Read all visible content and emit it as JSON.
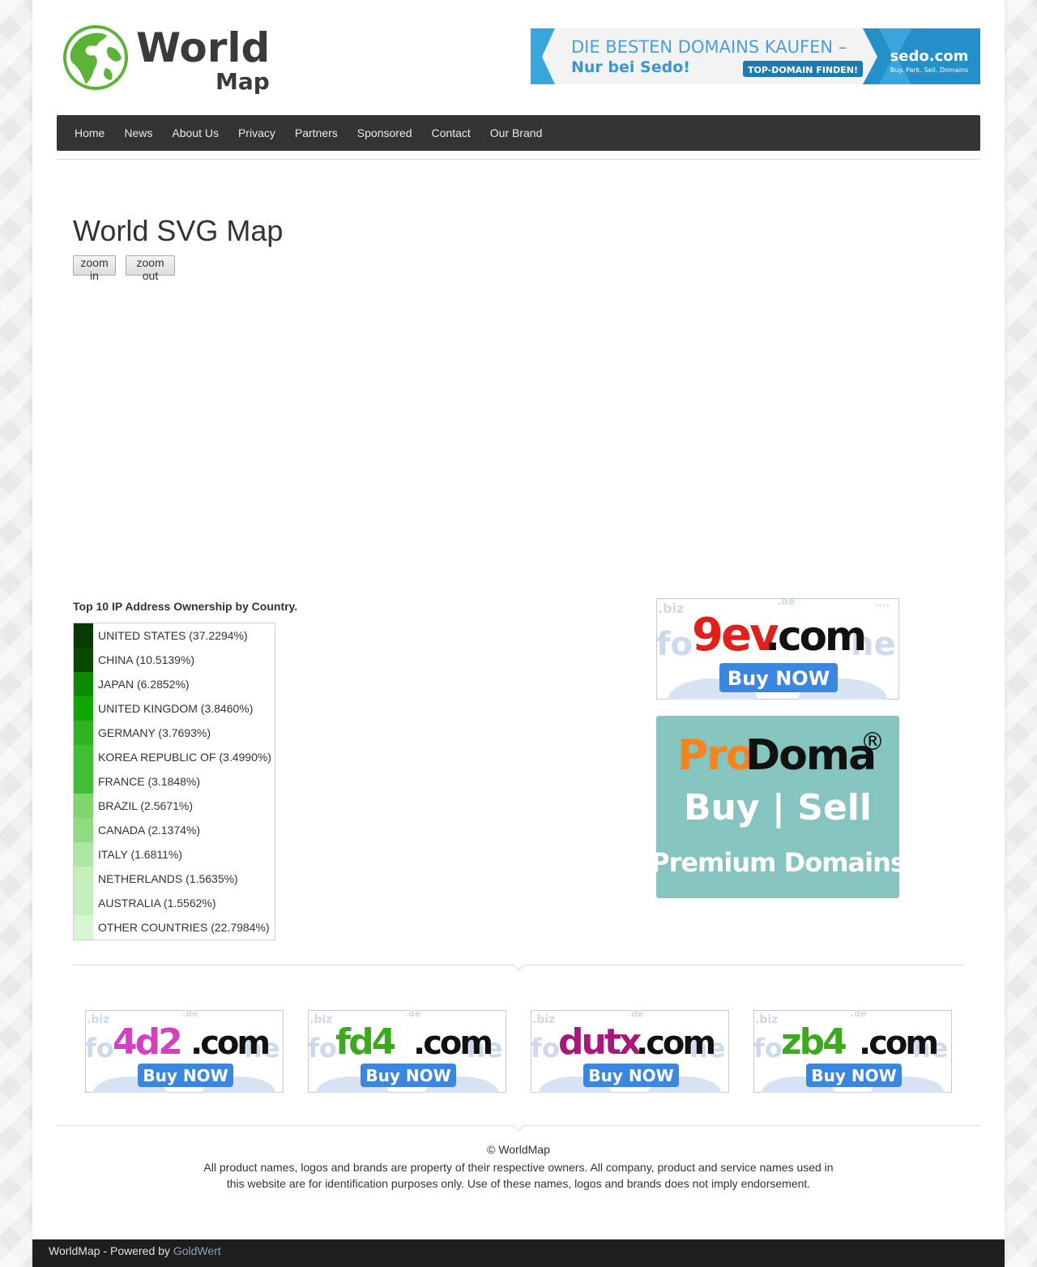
{
  "header": {
    "logo": {
      "word1": "World",
      "word2": "Map"
    },
    "banner": {
      "line1": "DIE BESTEN DOMAINS KAUFEN –",
      "line2": "Nur bei Sedo!",
      "cta": "TOP-DOMAIN FINDEN!",
      "brand": "sedo.com",
      "tagline": "Buy. Park. Sell. Domains"
    }
  },
  "nav": [
    "Home",
    "News",
    "About Us",
    "Privacy",
    "Partners",
    "Sponsored",
    "Contact",
    "Our Brand"
  ],
  "main": {
    "title": "World SVG Map",
    "zoom_in": "zoom in",
    "zoom_out": "zoom out",
    "legend_title": "Top 10 IP Address Ownership by Country.",
    "legend": [
      {
        "label": "UNITED STATES (37.2294%)",
        "color": "#073b00"
      },
      {
        "label": "CHINA (10.5139%)",
        "color": "#0a4a00"
      },
      {
        "label": "JAPAN (6.2852%)",
        "color": "#0c8a00"
      },
      {
        "label": "UNITED KINGDOM (3.8460%)",
        "color": "#11a500"
      },
      {
        "label": "GERMANY (3.7693%)",
        "color": "#2db41e"
      },
      {
        "label": "KOREA REPUBLIC OF (3.4990%)",
        "color": "#3fbf33"
      },
      {
        "label": "FRANCE (3.1848%)",
        "color": "#3fbf33"
      },
      {
        "label": "BRAZIL (2.5671%)",
        "color": "#7fd66f"
      },
      {
        "label": "CANADA (2.1374%)",
        "color": "#8fdc80"
      },
      {
        "label": "ITALY (1.6811%)",
        "color": "#aee6a3"
      },
      {
        "label": "NETHERLANDS (1.5635%)",
        "color": "#c5eebd"
      },
      {
        "label": "AUSTRALIA (1.5562%)",
        "color": "#c5eebd"
      },
      {
        "label": "OTHER COUNTRIES (22.7984%)",
        "color": "#d9f4d3"
      }
    ]
  },
  "ads": {
    "side": {
      "name": "9ev",
      "tld": ".com",
      "cta": "Buy NOW"
    },
    "prodoma": {
      "pro": "Pro",
      "doma": "Doma",
      "reg": "®",
      "line1": "Buy | Sell",
      "line2": "Premium Domains"
    },
    "row": [
      {
        "name": "4d2",
        "tld": ".com",
        "cta": "Buy NOW",
        "color": "#d63fbf"
      },
      {
        "name": "fd4",
        "tld": ".com",
        "cta": "Buy NOW",
        "color": "#3caa1c"
      },
      {
        "name": "dutx",
        "tld": ".com",
        "cta": "Buy NOW",
        "color": "#a8187a"
      },
      {
        "name": "zb4",
        "tld": ".com",
        "cta": "Buy NOW",
        "color": "#3caa1c"
      }
    ]
  },
  "footer": {
    "copyright": "© WorldMap",
    "disclaimer": "All product names, logos and brands are property of their respective owners. All company, product and service names used in this website are for identification purposes only. Use of these names, logos and brands does not imply endorsement.",
    "powered_prefix": "WorldMap - Powered by ",
    "powered_link": "GoldWert"
  }
}
